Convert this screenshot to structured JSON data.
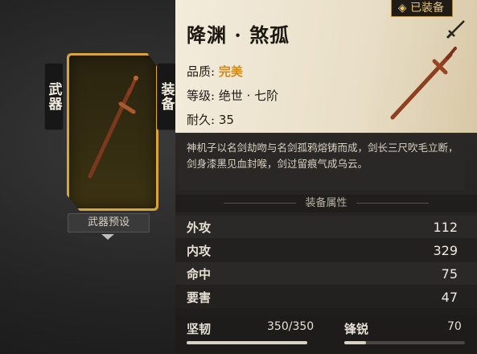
{
  "left": {
    "weapon_tab": "武器",
    "equip_tab": "装备",
    "preset_button": "武器预设"
  },
  "item": {
    "equipped_badge": "◈ 已装备",
    "name": "降渊 · 煞孤",
    "quality_label": "品质:",
    "quality_value": "完美",
    "level_label": "等级:",
    "level_value": "绝世 · 七阶",
    "durability_label": "耐久:",
    "durability_value": "35",
    "description": "神机子以名剑劫吻与名剑孤鸦熔铸而成，剑长三尺吹毛立断，剑身漆黑见血封喉，剑过留痕气成乌云。"
  },
  "stats_section": {
    "title": "装备属性",
    "rows": [
      {
        "label": "外攻",
        "value": "112"
      },
      {
        "label": "内攻",
        "value": "329"
      },
      {
        "label": "命中",
        "value": "75"
      },
      {
        "label": "要害",
        "value": "47"
      }
    ]
  },
  "bars": {
    "toughness_label": "坚韧",
    "toughness_value": "350/350",
    "toughness_fraction": 1.0,
    "sharpness_label": "锋锐",
    "sharpness_value": "70",
    "sharpness_fraction": 0.18
  },
  "colors": {
    "quality_gold": "#d48a12",
    "card_border": "#d9a43a",
    "badge_text": "#e9c36a"
  },
  "icons": {
    "edit": "sword-edit-icon",
    "preset_arrow": "chevron-down-icon"
  }
}
